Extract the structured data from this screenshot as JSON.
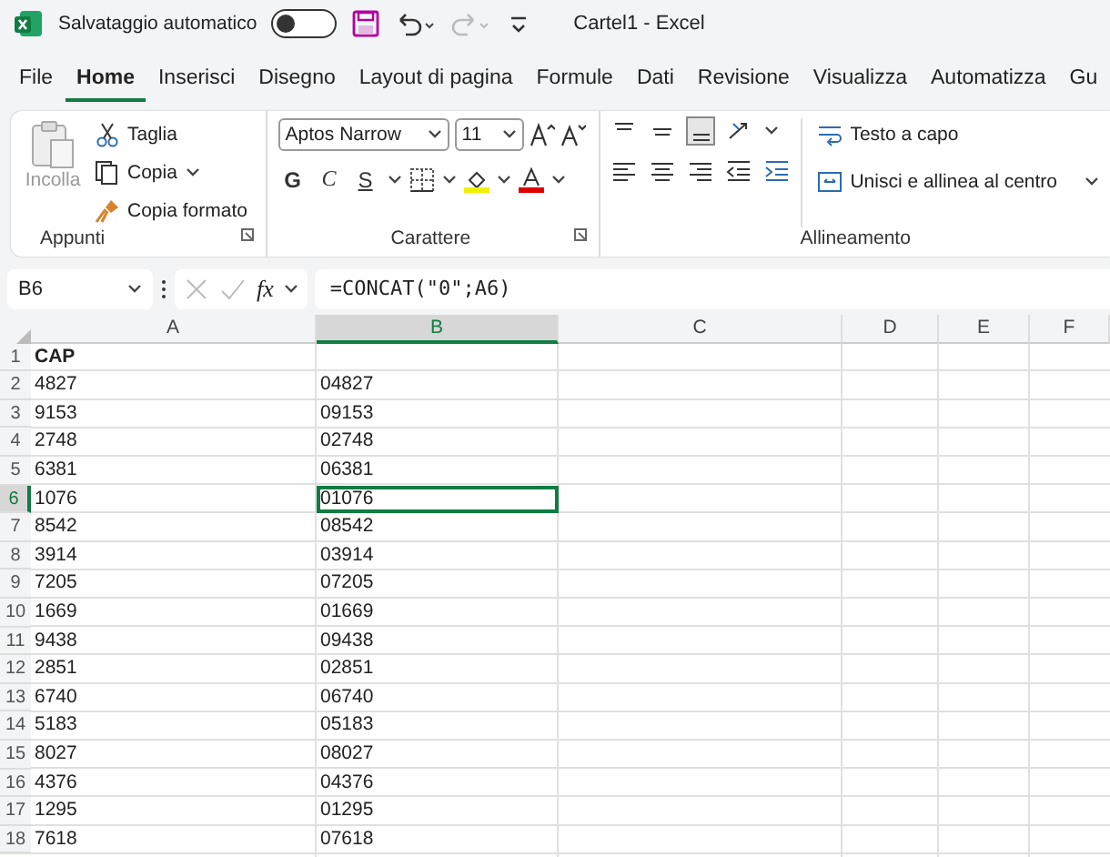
{
  "title_bar": {
    "autosave_label": "Salvataggio automatico",
    "autosave_on": false,
    "document_title": "Cartel1  -  Excel"
  },
  "menu_tabs": [
    {
      "label": "File",
      "selected": false
    },
    {
      "label": "Home",
      "selected": true
    },
    {
      "label": "Inserisci",
      "selected": false
    },
    {
      "label": "Disegno",
      "selected": false
    },
    {
      "label": "Layout di pagina",
      "selected": false
    },
    {
      "label": "Formule",
      "selected": false
    },
    {
      "label": "Dati",
      "selected": false
    },
    {
      "label": "Revisione",
      "selected": false
    },
    {
      "label": "Visualizza",
      "selected": false
    },
    {
      "label": "Automatizza",
      "selected": false
    },
    {
      "label": "Gu",
      "selected": false
    }
  ],
  "ribbon": {
    "clipboard": {
      "paste": "Incolla",
      "cut": "Taglia",
      "copy": "Copia",
      "format_painter": "Copia formato",
      "label": "Appunti"
    },
    "font": {
      "font_name": "Aptos Narrow",
      "font_size": "11",
      "bold": "G",
      "italic": "C",
      "underline": "S",
      "label": "Carattere"
    },
    "alignment": {
      "wrap_text": "Testo a capo",
      "merge_center": "Unisci e allinea al centro",
      "label": "Allineamento"
    }
  },
  "formula_bar": {
    "name_box": "B6",
    "function_label": "fx",
    "formula": "=CONCAT(\"0\";A6)"
  },
  "sheet": {
    "columns": [
      {
        "label": "A",
        "selected": false
      },
      {
        "label": "B",
        "selected": true
      },
      {
        "label": "C",
        "selected": false
      },
      {
        "label": "D",
        "selected": false
      },
      {
        "label": "E",
        "selected": false
      },
      {
        "label": "F",
        "selected": false
      }
    ],
    "rows": [
      {
        "number": "1",
        "selected": false,
        "header": true,
        "cells": [
          "CAP"
        ]
      },
      {
        "number": "2",
        "selected": false,
        "header": false,
        "cells": [
          "4827",
          "04827"
        ]
      },
      {
        "number": "3",
        "selected": false,
        "header": false,
        "cells": [
          "9153",
          "09153"
        ]
      },
      {
        "number": "4",
        "selected": false,
        "header": false,
        "cells": [
          "2748",
          "02748"
        ]
      },
      {
        "number": "5",
        "selected": false,
        "header": false,
        "cells": [
          "6381",
          "06381"
        ]
      },
      {
        "number": "6",
        "selected": true,
        "header": false,
        "cells": [
          "1076",
          "01076"
        ]
      },
      {
        "number": "7",
        "selected": false,
        "header": false,
        "cells": [
          "8542",
          "08542"
        ]
      },
      {
        "number": "8",
        "selected": false,
        "header": false,
        "cells": [
          "3914",
          "03914"
        ]
      },
      {
        "number": "9",
        "selected": false,
        "header": false,
        "cells": [
          "7205",
          "07205"
        ]
      },
      {
        "number": "10",
        "selected": false,
        "header": false,
        "cells": [
          "1669",
          "01669"
        ]
      },
      {
        "number": "11",
        "selected": false,
        "header": false,
        "cells": [
          "9438",
          "09438"
        ]
      },
      {
        "number": "12",
        "selected": false,
        "header": false,
        "cells": [
          "2851",
          "02851"
        ]
      },
      {
        "number": "13",
        "selected": false,
        "header": false,
        "cells": [
          "6740",
          "06740"
        ]
      },
      {
        "number": "14",
        "selected": false,
        "header": false,
        "cells": [
          "5183",
          "05183"
        ]
      },
      {
        "number": "15",
        "selected": false,
        "header": false,
        "cells": [
          "8027",
          "08027"
        ]
      },
      {
        "number": "16",
        "selected": false,
        "header": false,
        "cells": [
          "4376",
          "04376"
        ]
      },
      {
        "number": "17",
        "selected": false,
        "header": false,
        "cells": [
          "1295",
          "01295"
        ]
      },
      {
        "number": "18",
        "selected": false,
        "header": false,
        "cells": [
          "7618",
          "07618"
        ]
      }
    ]
  }
}
